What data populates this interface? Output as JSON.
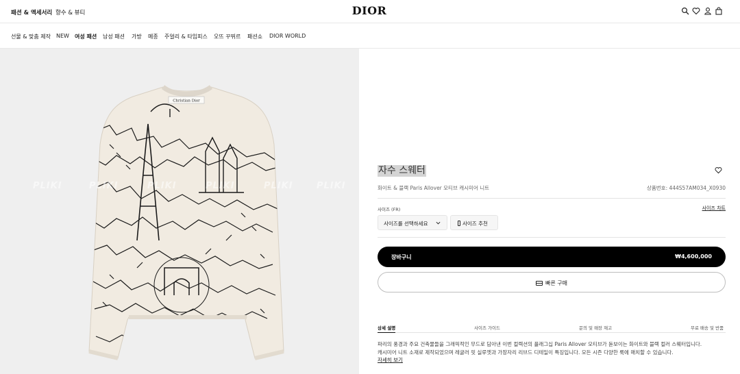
{
  "header": {
    "left_links": [
      "패션 & 액세서리",
      "향수 & 뷰티"
    ],
    "logo": "DIOR",
    "icons": [
      "search-icon",
      "heart-icon",
      "user-icon",
      "bag-icon"
    ]
  },
  "nav": {
    "items": [
      "선물 & 맞춤 제작",
      "NEW",
      "여성 패션",
      "남성 패션",
      "가방",
      "메종",
      "주얼리 & 타임피스",
      "오뜨 꾸뛰르",
      "패션쇼",
      "DIOR WORLD"
    ],
    "active": "여성 패션"
  },
  "gallery": {
    "watermark": "PLIKI",
    "sweater_tag": "Christian Dior",
    "colors": {
      "background": "#efefef",
      "knit": "#f1ebe1",
      "ink": "#1a1a1a"
    }
  },
  "product": {
    "title": "자수 스웨터",
    "subtitle": "화이트 & 블랙 Paris Allover 모티브 캐시미어 니트",
    "reference": "상품번호: 444S57AM034_X0930",
    "size_label": "사이즈 (FR)",
    "size_chart": "사이즈 차트",
    "size_select_placeholder": "사이즈를 선택하세요",
    "size_recommend": "사이즈 추천",
    "cart_label": "장바구니",
    "price": "₩4,600,000",
    "quick_buy": "빠른 구매"
  },
  "tabs": [
    "상세 설명",
    "사이즈 가이드",
    "문의 및 매장 재고",
    "무료 배송 및 반품"
  ],
  "description": {
    "line1": "파리의 풍경과 주요 건축물들을 그래픽적인 무드로 담아낸 이번 컬렉션의 플래그십 Paris Allover 모티브가 돋보이는 화이트와 블랙 컬러 스웨터입니다.",
    "line2": "캐시미어 니트 소재로 제작되었으며 레귤러 핏 실루엣과 가장자리 리브드 디테일이 특징입니다. 모든 시즌 다양한 룩에 매치할 수 있습니다.",
    "more": "자세히 보기"
  }
}
